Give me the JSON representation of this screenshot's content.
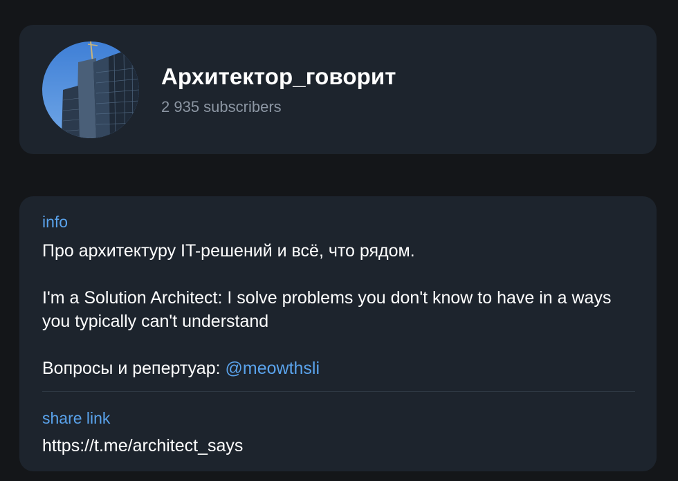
{
  "channel": {
    "name": "Архитектор_говорит",
    "subscribers": "2 935 subscribers"
  },
  "info": {
    "label": "info",
    "line1": "Про архитектуру IT-решений и всё, что рядом.",
    "line2": "I'm a Solution Architect: I solve problems you don't know to have in a ways you typically can't understand",
    "contact_prefix": "Вопросы и репертуар: ",
    "contact_mention": "@meowthsli"
  },
  "share": {
    "label": "share link",
    "url": "https://t.me/architect_says"
  },
  "colors": {
    "background": "#141619",
    "card": "#1d242d",
    "accent": "#5aa3ec",
    "muted": "#8c96a3"
  }
}
